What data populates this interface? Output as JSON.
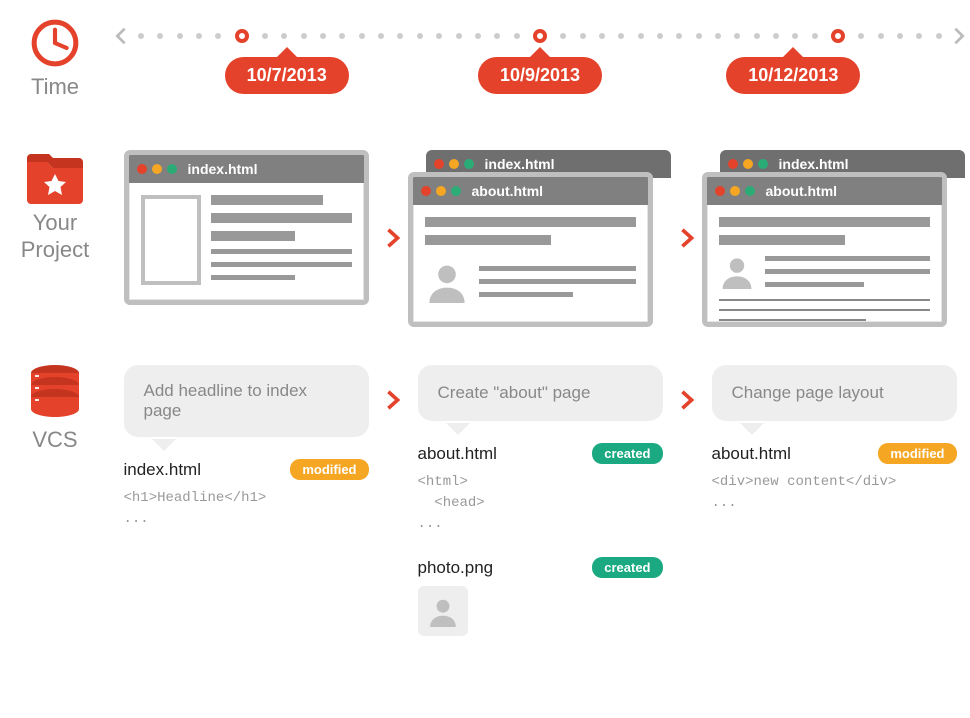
{
  "rows": {
    "time": {
      "label": "Time"
    },
    "project": {
      "label": "Your\nProject"
    },
    "vcs": {
      "label": "VCS"
    }
  },
  "timeline": {
    "dates": [
      "10/7/2013",
      "10/9/2013",
      "10/12/2013"
    ]
  },
  "windows": {
    "col1": {
      "front": "index.html"
    },
    "col2": {
      "back": "index.html",
      "front": "about.html"
    },
    "col3": {
      "back": "index.html",
      "front": "about.html"
    }
  },
  "commits": [
    {
      "message": "Add headline to index page",
      "files": [
        {
          "name": "index.html",
          "status": "modified",
          "code": "<h1>Headline</h1>\n..."
        }
      ]
    },
    {
      "message": "Create \"about\" page",
      "files": [
        {
          "name": "about.html",
          "status": "created",
          "code": "<html>\n  <head>\n..."
        },
        {
          "name": "photo.png",
          "status": "created",
          "is_image": true
        }
      ]
    },
    {
      "message": "Change page layout",
      "files": [
        {
          "name": "about.html",
          "status": "modified",
          "code": "<div>new content</div>\n..."
        }
      ]
    }
  ],
  "status_labels": {
    "modified": "modified",
    "created": "created"
  }
}
